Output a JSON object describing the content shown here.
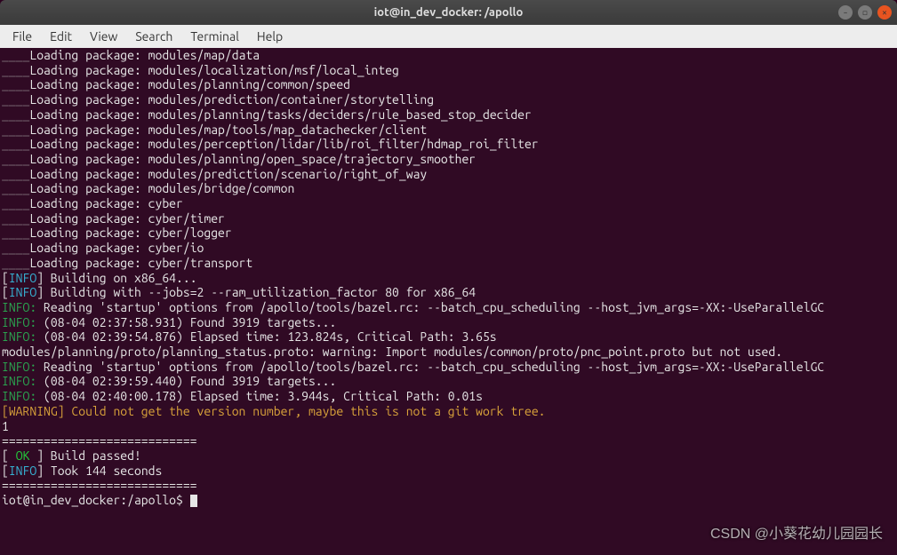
{
  "window": {
    "title": "iot@in_dev_docker: /apollo"
  },
  "menu": {
    "file": "File",
    "edit": "Edit",
    "view": "View",
    "search": "Search",
    "terminal": "Terminal",
    "help": "Help"
  },
  "loading_prefix": "____Loading package: ",
  "packages": [
    "modules/map/data",
    "modules/localization/msf/local_integ",
    "modules/planning/common/speed",
    "modules/prediction/container/storytelling",
    "modules/planning/tasks/deciders/rule_based_stop_decider",
    "modules/map/tools/map_datachecker/client",
    "modules/perception/lidar/lib/roi_filter/hdmap_roi_filter",
    "modules/planning/open_space/trajectory_smoother",
    "modules/prediction/scenario/right_of_way",
    "modules/bridge/common",
    "cyber",
    "cyber/timer",
    "cyber/logger",
    "cyber/io",
    "cyber/transport"
  ],
  "build": {
    "info_tag": "INFO",
    "building_on": "] Building on x86_64...",
    "building_with": "] Building with --jobs=2 --ram_utilization_factor 80 for x86_64",
    "startup1": " Reading 'startup' options from /apollo/tools/bazel.rc: --batch_cpu_scheduling --host_jvm_args=-XX:-UseParallelGC",
    "found1": " (08-04 02:37:58.931) Found 3919 targets...",
    "elapsed1": " (08-04 02:39:54.876) Elapsed time: 123.824s, Critical Path: 3.65s",
    "proto_warn": "modules/planning/proto/planning_status.proto: warning: Import modules/common/proto/pnc_point.proto but not used.",
    "startup2": " Reading 'startup' options from /apollo/tools/bazel.rc: --batch_cpu_scheduling --host_jvm_args=-XX:-UseParallelGC",
    "found2": " (08-04 02:39:59.440) Found 3919 targets...",
    "elapsed2": " (08-04 02:40:00.178) Elapsed time: 3.944s, Critical Path: 0.01s",
    "warning": "[WARNING] Could not get the version number, maybe this is not a git work tree.",
    "one": "1",
    "sep": "============================",
    "ok": "OK",
    "passed": " ] Build passed!",
    "took": "] Took 144 seconds",
    "prompt": "iot@in_dev_docker:/apollo$ ",
    "info_colon": "INFO:"
  },
  "watermark": "CSDN @小葵花幼儿园园长"
}
